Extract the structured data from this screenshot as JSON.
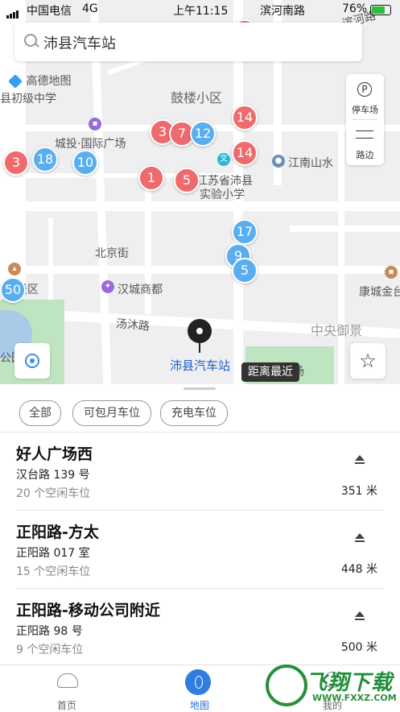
{
  "status_bar": {
    "carrier": "中国电信",
    "network": "4G",
    "time": "上午11:15",
    "location": "滨河南路",
    "battery": "76%"
  },
  "search": {
    "value": "沛县汽车站"
  },
  "map": {
    "logo": "高德地图",
    "labels": {
      "school1": "县初级中学",
      "gulou": "鼓楼小区",
      "chengtou": "城投·国际广场",
      "jiangnan": "江南山水",
      "jiangsu1": "江苏省沛县",
      "jiangsu2": "实验小学",
      "beijing": "北京街",
      "hancheng": "汉城商都",
      "jingqu": "景区",
      "kangcheng": "康城金台",
      "tangmu": "汤沐路",
      "zhongyang": "中央御景",
      "gongyuan": "公园",
      "chang": "场",
      "binhe": "滨河路"
    },
    "pins": {
      "red": [
        "3",
        "7",
        "3",
        "14",
        "14",
        "1",
        "5",
        "3"
      ],
      "blue": [
        "12",
        "18",
        "10",
        "17",
        "9",
        "5",
        "50"
      ]
    },
    "side_panel": {
      "parking_icon": "P",
      "parking_label": "停车场",
      "roadside_label": "路边"
    },
    "destination_label": "沛县汽车站",
    "nearest_tag": "距离最近",
    "favorite_icon": "☆"
  },
  "filters": [
    "全部",
    "可包月车位",
    "充电车位"
  ],
  "lots": [
    {
      "name": "好人广场西",
      "address": "汉台路 139 号",
      "free": "20 个空闲车位",
      "distance": "351 米"
    },
    {
      "name": "正阳路-方太",
      "address": "正阳路 017 室",
      "free": "15 个空闲车位",
      "distance": "448 米"
    },
    {
      "name": "正阳路-移动公司附近",
      "address": "正阳路 98 号",
      "free": "9 个空闲车位",
      "distance": "500 米"
    }
  ],
  "tabs": [
    {
      "label": "首页",
      "icon": "cloud-icon"
    },
    {
      "label": "地图",
      "icon": "map-icon"
    },
    {
      "label": "我的",
      "icon": "person-icon"
    }
  ],
  "watermark": {
    "title": "飞翔下载",
    "url": "WWW.FXXZ.COM"
  }
}
